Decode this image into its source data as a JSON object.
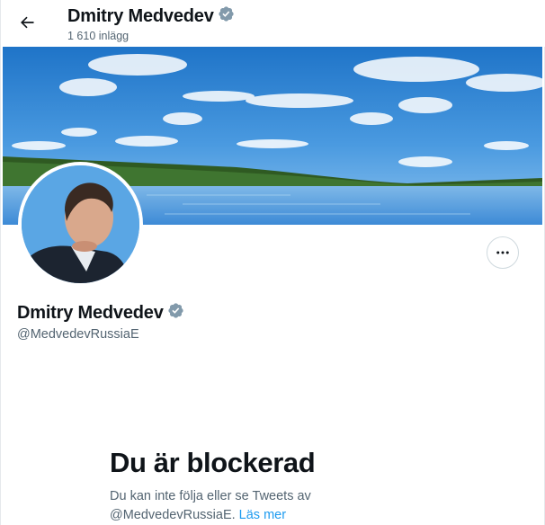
{
  "header": {
    "name": "Dmitry Medvedev",
    "post_count": "1 610 inlägg",
    "back_icon": "arrow-left-icon",
    "verified_icon": "verified-badge-icon"
  },
  "profile": {
    "name": "Dmitry Medvedev",
    "handle": "@MedvedevRussiaE",
    "more_icon": "more-horizontal-icon"
  },
  "blocked": {
    "title": "Du är blockerad",
    "line1": "Du kan inte följa eller se Tweets av",
    "handle": "@MedvedevRussiaE.",
    "learn_more": "Läs mer"
  },
  "colors": {
    "link": "#1d9bf0",
    "secondary_text": "#536471",
    "verified_badge": "#829aab"
  }
}
